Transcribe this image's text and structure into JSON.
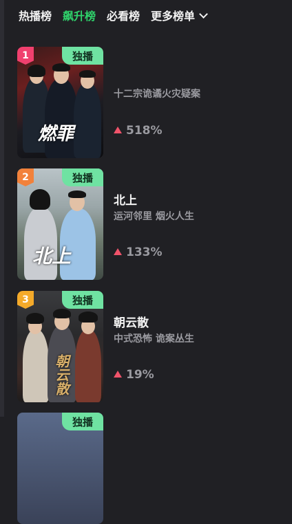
{
  "tabs": [
    {
      "label": "热播榜"
    },
    {
      "label": "飙升榜"
    },
    {
      "label": "必看榜"
    },
    {
      "label": "更多榜单"
    }
  ],
  "active_tab": "飙升榜",
  "colors": {
    "accent": "#2fd26b",
    "badge": "#6fe2a2",
    "rank1": "#f0406e",
    "rank2": "#f2813a",
    "rank3": "#f4aa2a",
    "trend_up": "#f0536a"
  },
  "items": [
    {
      "rank": "1",
      "badge": "独播",
      "title": "",
      "subtitle": "十二宗诡谲火灾疑案",
      "growth": "518%",
      "poster_text": "燃罪"
    },
    {
      "rank": "2",
      "badge": "独播",
      "title": "北上",
      "subtitle": "运河邻里 烟火人生",
      "growth": "133%",
      "poster_text": "北上"
    },
    {
      "rank": "3",
      "badge": "独播",
      "title": "朝云散",
      "subtitle": "中式恐怖 诡案丛生",
      "growth": "19%",
      "poster_text": "朝云散"
    },
    {
      "badge": "独播"
    }
  ]
}
